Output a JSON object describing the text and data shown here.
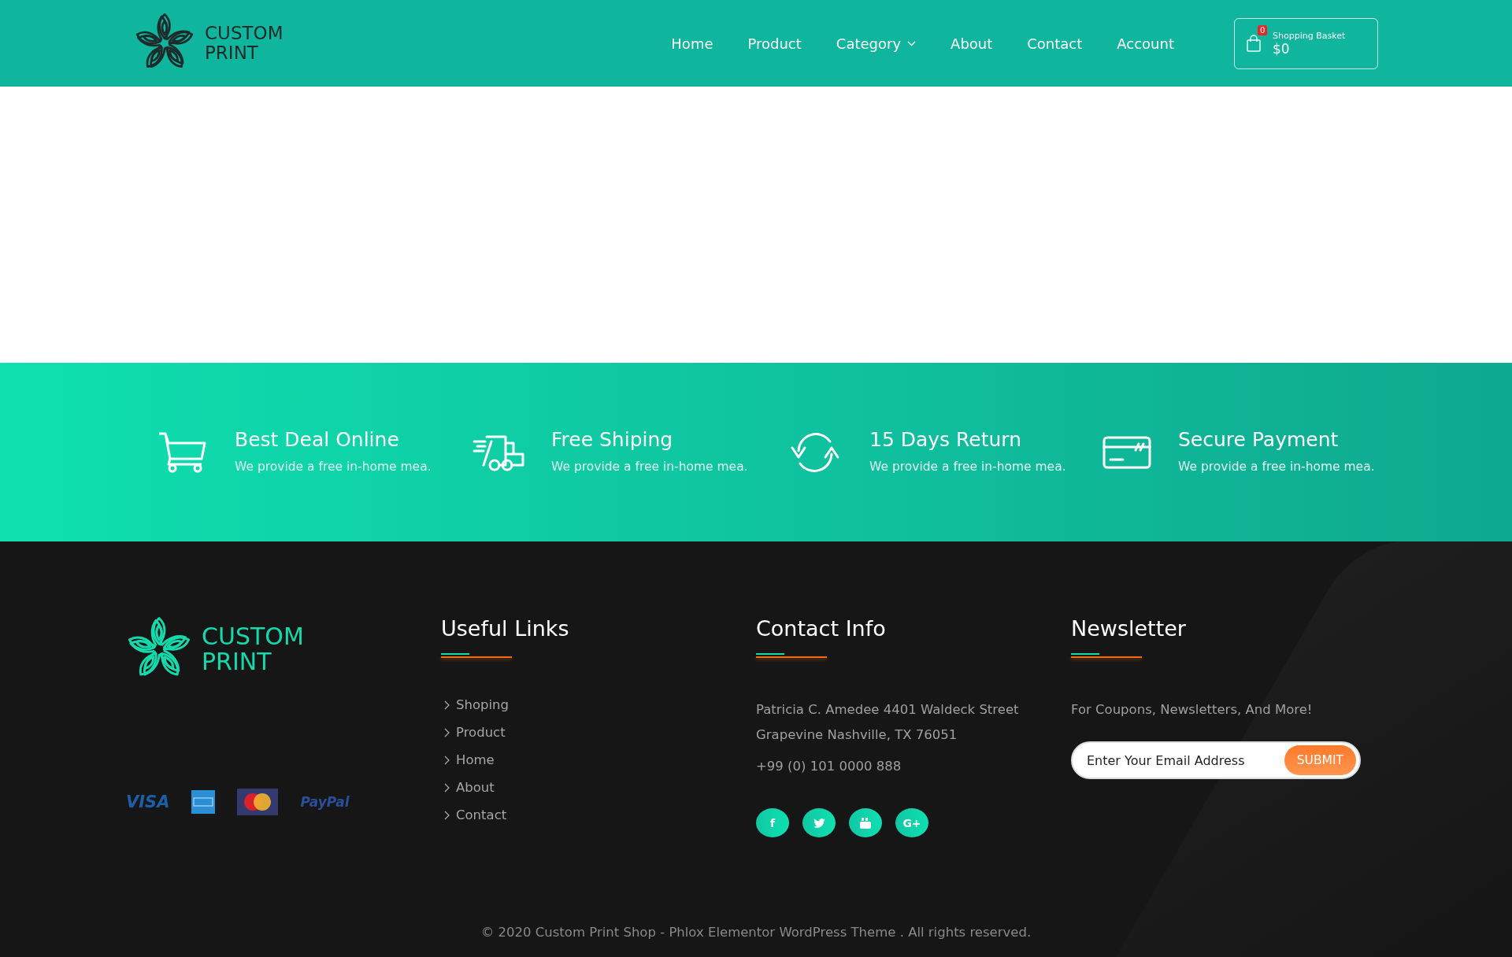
{
  "header": {
    "logo_lines": [
      "CUSTOM",
      "PRINT"
    ],
    "nav": [
      {
        "label": "Home",
        "has_dropdown": false
      },
      {
        "label": "Product",
        "has_dropdown": false
      },
      {
        "label": "Category",
        "has_dropdown": true
      },
      {
        "label": "About",
        "has_dropdown": false
      },
      {
        "label": "Contact",
        "has_dropdown": false
      },
      {
        "label": "Account",
        "has_dropdown": false
      }
    ],
    "basket": {
      "count": "0",
      "label": "Shopping Basket",
      "amount": "$0"
    }
  },
  "features": [
    {
      "kind": "cart",
      "title": "Best Deal Online",
      "text": "We provide a free in-home mea."
    },
    {
      "kind": "truck",
      "title": "Free Shiping",
      "text": "We provide a free in-home mea."
    },
    {
      "kind": "refresh",
      "title": "15 Days Return",
      "text": "We provide a free in-home mea."
    },
    {
      "kind": "card",
      "title": "Secure Payment",
      "text": "We provide a free in-home mea."
    }
  ],
  "footer": {
    "logo_lines": [
      "CUSTOM",
      "PRINT"
    ],
    "payments": [
      {
        "kind": "visa",
        "label": "VISA"
      },
      {
        "kind": "amex"
      },
      {
        "kind": "mastercard"
      },
      {
        "kind": "paypal",
        "label": "PayPal"
      }
    ],
    "useful_links": {
      "title": "Useful Links",
      "items": [
        "Shoping",
        "Product",
        "Home",
        "About",
        "Contact"
      ]
    },
    "contact": {
      "title": "Contact Info",
      "address": "Patricia C. Amedee 4401 Waldeck Street Grapevine Nashville, TX 76051",
      "phone": "+99 (0) 101 0000 888",
      "socials": [
        {
          "kind": "facebook",
          "glyph": "f"
        },
        {
          "kind": "twitter"
        },
        {
          "kind": "youtube"
        },
        {
          "kind": "google-plus",
          "glyph": "G+"
        }
      ]
    },
    "newsletter": {
      "title": "Newsletter",
      "text": "For Coupons, Newsletters, And More!",
      "placeholder": "Enter Your Email Address",
      "button": "SUBMIT"
    },
    "copyright": "© 2020 Custom Print Shop - Phlox Elementor WordPress Theme . All rights reserved."
  }
}
